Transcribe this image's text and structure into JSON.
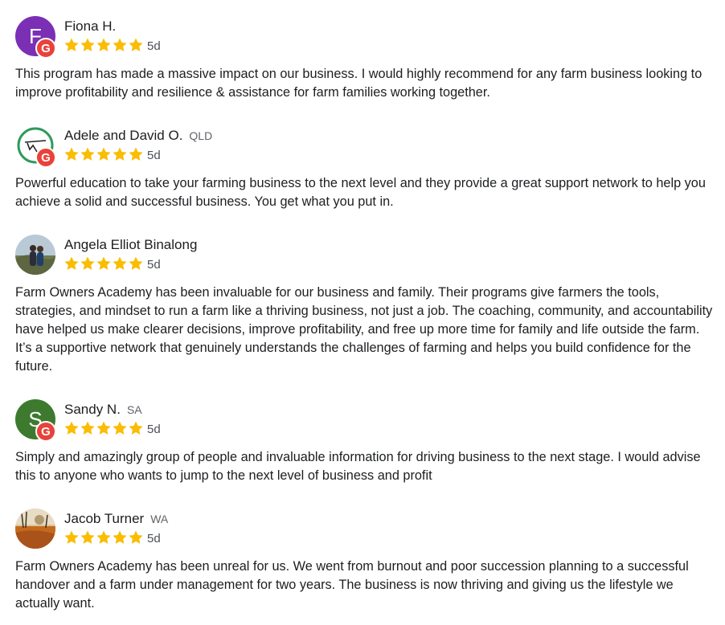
{
  "colors": {
    "star": "#fbbc04",
    "google_badge": "#e8423b",
    "text": "#1c1e21",
    "muted": "#5f6368"
  },
  "reviews": [
    {
      "name": "Fiona H.",
      "region": "",
      "rating": 5,
      "age": "5d",
      "avatar": {
        "type": "letter",
        "letter": "F",
        "color": "#7b2fb5"
      },
      "source_badge": "G",
      "text": "This program has made a massive impact on our business. I would highly recommend for any farm business looking to improve profitability and resilience & assistance for farm families working together."
    },
    {
      "name": "Adele and David O.",
      "region": "QLD",
      "rating": 5,
      "age": "5d",
      "avatar": {
        "type": "logo",
        "letter": ""
      },
      "source_badge": "G",
      "text": "Powerful education to take your farming business to the next level and they provide a great support network to help you achieve a solid and successful business. You get what you put in."
    },
    {
      "name": "Angela Elliot Binalong",
      "region": "",
      "rating": 5,
      "age": "5d",
      "avatar": {
        "type": "photo",
        "letter": ""
      },
      "source_badge": "",
      "text": "Farm Owners Academy has been invaluable for our business and family. Their programs give farmers the tools, strategies, and mindset to run a farm like a thriving business, not just a job. The coaching, community, and accountability have helped us make clearer decisions, improve profitability, and free up more time for family and life outside the farm. It’s a supportive network that genuinely understands the challenges of farming and helps you build confidence for the future."
    },
    {
      "name": "Sandy N.",
      "region": "SA",
      "rating": 5,
      "age": "5d",
      "avatar": {
        "type": "letter",
        "letter": "S",
        "color": "#3d7a2e"
      },
      "source_badge": "G",
      "text": "Simply and amazingly group of people and invaluable information for driving business to the next stage. I would advise this to anyone who wants to jump to the next level of business and profit"
    },
    {
      "name": "Jacob Turner",
      "region": "WA",
      "rating": 5,
      "age": "5d",
      "avatar": {
        "type": "photo",
        "letter": ""
      },
      "source_badge": "",
      "text": "Farm Owners Academy has been unreal for us. We went from burnout and poor succession planning to a successful handover and a farm under management for two years. The business is now thriving and giving us the lifestyle we actually want."
    }
  ]
}
